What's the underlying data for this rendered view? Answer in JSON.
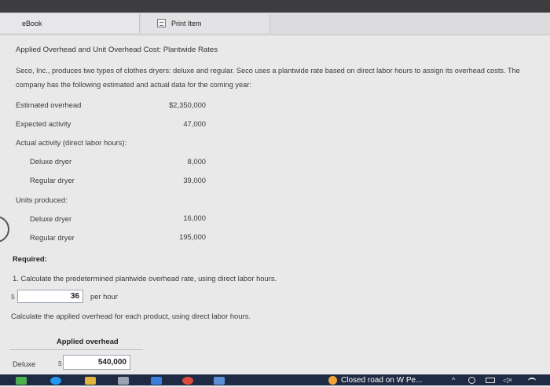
{
  "tabs": {
    "ebook": "eBook",
    "print": "Print Item"
  },
  "problem": {
    "title": "Applied Overhead and Unit Overhead Cost: Plantwide Rates",
    "description": "Seco, Inc., produces two types of clothes dryers: deluxe and regular. Seco uses a plantwide rate based on direct labor hours to assign its overhead costs. The company has the following estimated and actual data for the coming year:",
    "rows": {
      "est_overhead_label": "Estimated overhead",
      "est_overhead_value": "$2,350,000",
      "exp_activity_label": "Expected activity",
      "exp_activity_value": "47,000",
      "actual_activity_label": "Actual activity (direct labor hours):",
      "deluxe_label": "Deluxe dryer",
      "deluxe_hours": "8,000",
      "regular_label": "Regular dryer",
      "regular_hours": "39,000",
      "units_label": "Units produced:",
      "deluxe_units_label": "Deluxe dryer",
      "deluxe_units": "16,000",
      "regular_units_label": "Regular dryer",
      "regular_units": "195,000"
    }
  },
  "required": {
    "heading": "Required:",
    "q1": "1. Calculate the predetermined plantwide overhead rate, using direct labor hours.",
    "q1_currency": "$",
    "q1_answer": "36",
    "q1_unit": "per hour",
    "q2": "Calculate the applied overhead for each product, using direct labor hours.",
    "table_header": "Applied overhead",
    "deluxe_row_label": "Deluxe",
    "deluxe_currency": "$",
    "deluxe_answer": "540,000"
  },
  "taskbar": {
    "news": "Closed road on W Pe...",
    "tray_chevron": "^",
    "tray_volume": "◁×"
  },
  "colors": {
    "taskbar": "#1f2a44",
    "page_bg": "#e9e9ea",
    "news_icon": "#f2a33a"
  }
}
